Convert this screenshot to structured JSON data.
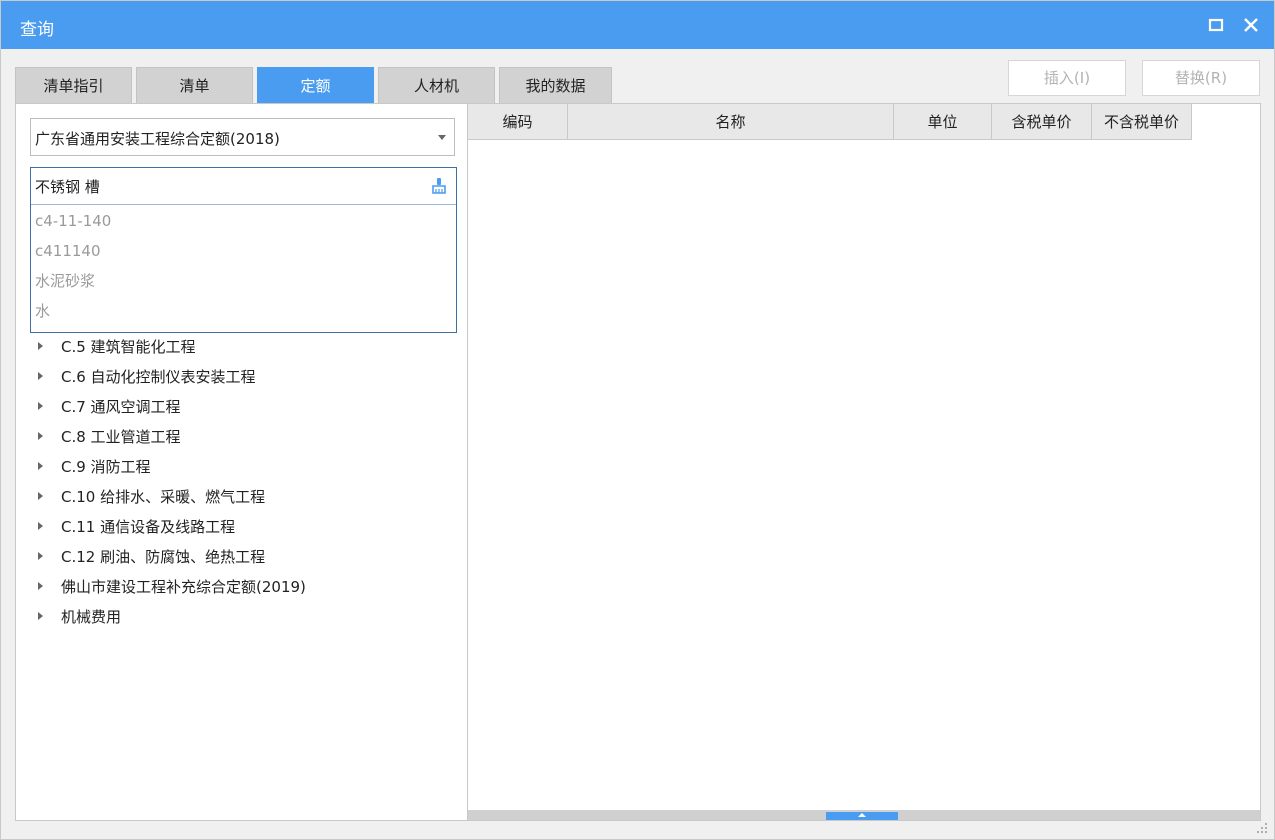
{
  "window": {
    "title": "查询"
  },
  "tabs": [
    {
      "label": "清单指引"
    },
    {
      "label": "清单"
    },
    {
      "label": "定额",
      "active": true
    },
    {
      "label": "人材机"
    },
    {
      "label": "我的数据"
    }
  ],
  "actions": {
    "insert_label": "插入(I)",
    "replace_label": "替换(R)"
  },
  "left_panel": {
    "library_select": "广东省通用安装工程综合定额(2018)",
    "search_value": "不锈钢 槽",
    "suggestions": [
      "c4-11-140",
      "c411140",
      "水泥砂浆",
      "水"
    ],
    "tree": [
      "C.5 建筑智能化工程",
      "C.6 自动化控制仪表安装工程",
      "C.7 通风空调工程",
      "C.8 工业管道工程",
      "C.9 消防工程",
      "C.10 给排水、采暖、燃气工程",
      "C.11 通信设备及线路工程",
      "C.12 刷油、防腐蚀、绝热工程",
      "佛山市建设工程补充综合定额(2019)",
      "机械费用"
    ]
  },
  "grid": {
    "columns": [
      "编码",
      "名称",
      "单位",
      "含税单价",
      "不含税单价"
    ]
  },
  "colors": {
    "accent": "#4a9cf0"
  }
}
